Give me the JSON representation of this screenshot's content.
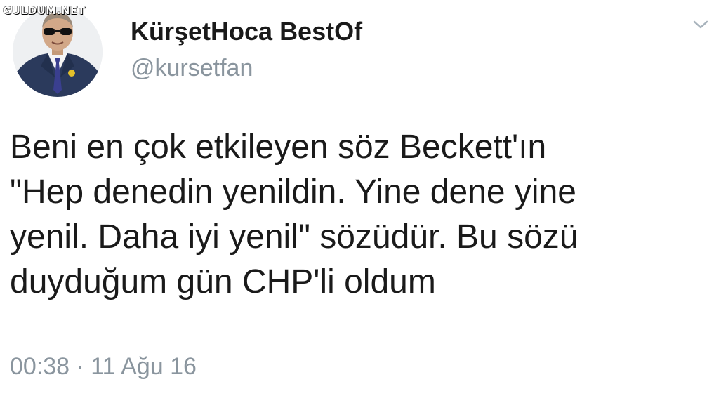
{
  "watermark": "GULDUM.NET",
  "author": {
    "avatar_icon": "profile-photo-avatar",
    "display_name": "KürşetHoca BestOf",
    "handle": "@kursetfan"
  },
  "menu_icon": "chevron-down-icon",
  "tweet": {
    "lines": [
      "Beni en çok etkileyen söz Beckett'ın",
      "\"Hep denedin yenildin. Yine dene yine",
      "yenil. Daha iyi yenil\" sözüdür. Bu sözü",
      "duyduğum gün CHP'li oldum"
    ],
    "timestamp": "00:38 · 11 Ağu 16"
  },
  "colors": {
    "text": "#1a1a1a",
    "muted": "#8a959e",
    "background": "#ffffff"
  }
}
